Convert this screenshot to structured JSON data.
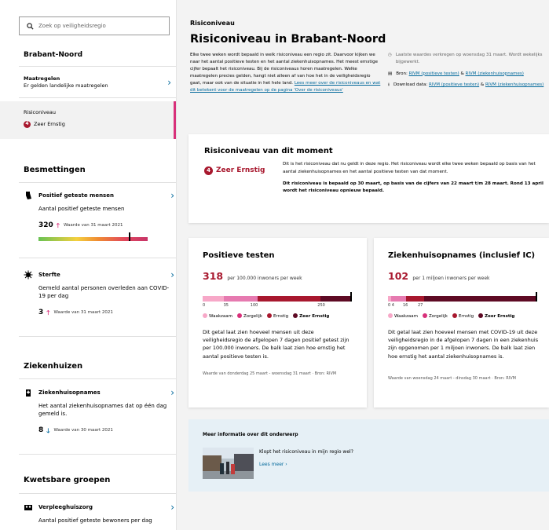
{
  "sidebar": {
    "search_placeholder": "Zoek op veiligheidsregio",
    "region": "Brabant-Noord",
    "maatregelen": {
      "title": "Maatregelen",
      "subtitle": "Er gelden landelijke maatregelen"
    },
    "risiconiveau": {
      "title": "Risiconiveau",
      "level_number": "4",
      "level_label": "Zeer Ernstig"
    },
    "besmettingen": {
      "heading": "Besmettingen",
      "positief": {
        "title": "Positief geteste mensen",
        "desc": "Aantal positief geteste mensen",
        "value": "320",
        "note": "Waarde van 31 maart 2021",
        "bar_fraction": 0.83
      },
      "sterfte": {
        "title": "Sterfte",
        "desc": "Gemeld aantal personen overleden aan COVID-19 per dag",
        "value": "3",
        "note": "Waarde van 31 maart 2021"
      }
    },
    "ziekenhuizen": {
      "heading": "Ziekenhuizen",
      "opnames": {
        "title": "Ziekenhuisopnames",
        "desc": "Het aantal ziekenhuisopnames dat op één dag gemeld is.",
        "value": "8",
        "note": "Waarde van 30 maart 2021"
      }
    },
    "kwetsbare": {
      "heading": "Kwetsbare groepen",
      "verpleeg": {
        "title": "Verpleeghuiszorg",
        "desc": "Aantal positief geteste bewoners per dag"
      }
    }
  },
  "header": {
    "kicker": "Risiconiveau",
    "title": "Risiconiveau in Brabant-Noord",
    "intro_text": "Elke twee weken wordt bepaald in welk risiconiveau een regio zit. Daarvoor kijken we naar het aantal positieve testen en het aantal ziekenhuisopnames. Het meest ernstige cijfer bepaalt het risiconiveau. Bij de risiconiveaus horen maatregelen. Welke maatregelen precies gelden, hangt niet alleen af van hoe het in de veiligheidsregio gaat, maar ook van de situatie in het hele land. ",
    "intro_link": "Lees meer over de risiconiveaus en wat dit betekent voor de maatregelen op de pagina 'Over de risiconiveaus'",
    "meta_updated": "Laatste waardes verkregen op woensdag 31 maart. Wordt wekelijks bijgewerkt.",
    "meta_source_prefix": "Bron: ",
    "meta_source_link1": "RIVM (positieve testen)",
    "meta_source_amp": " & ",
    "meta_source_link2": "RIVM (ziekenhuisopnames)",
    "meta_download_prefix": "Download data: ",
    "meta_download_link1": "RIVM (positieve testen)",
    "meta_download_amp": " & ",
    "meta_download_link2": "RIVM (ziekenhuisopnames)"
  },
  "moment_card": {
    "title": "Risiconiveau van dit moment",
    "level_number": "4",
    "level_label": "Zeer Ernstig",
    "text1": "Dit is het risiconiveau dat nu geldt in deze regio. Het risiconiveau wordt elke twee weken bepaald op basis van het aantal ziekenhuisopnames en het aantal positieve testen van dat moment.",
    "text2": "Dit risiconiveau is bepaald op 30 maart, op basis van de cijfers van 22 maart t/m 28 maart. Rond 13 april wordt het risiconiveau opnieuw bepaald."
  },
  "legend": [
    "Waakzaam",
    "Zorgelijk",
    "Ernstig",
    "Zeer Ernstig"
  ],
  "legend_colors": [
    "#f7a8c8",
    "#d8307a",
    "#a8182e",
    "#5e0a24"
  ],
  "testen_card": {
    "title": "Positieve testen",
    "value": "318",
    "unit": "per 100.000 inwoners per week",
    "ticks": [
      "0",
      "35",
      "100",
      "250"
    ],
    "text": "Dit getal laat zien hoeveel mensen uit deze veiligheidsregio de afgelopen 7 dagen positief getest zijn per 100.000 inwoners. De balk laat zien hoe ernstig het aantal positieve testen is.",
    "source": "Waarde van donderdag 25 maart - woensdag 31 maart · Bron: RIVM"
  },
  "opnames_card": {
    "title": "Ziekenhuisopnames (inclusief IC)",
    "value": "102",
    "unit": "per 1 miljoen inwoners per week",
    "ticks": [
      "0",
      "4",
      "16",
      "27"
    ],
    "text": "Dit getal laat zien hoeveel mensen met COVID-19 uit deze veiligheidsregio in de afgelopen 7 dagen in een ziekenhuis zijn opgenomen per 1 miljoen inwoners. De balk laat zien hoe ernstig het aantal ziekenhuisopnames is.",
    "source": "Waarde van woensdag 24 maart - dinsdag 30 maart · Bron: RIVM"
  },
  "more_info": {
    "heading": "Meer informatie over dit onderwerp",
    "question": "Klopt het risiconiveau in mijn regio wel?",
    "link": "Lees meer ›"
  }
}
